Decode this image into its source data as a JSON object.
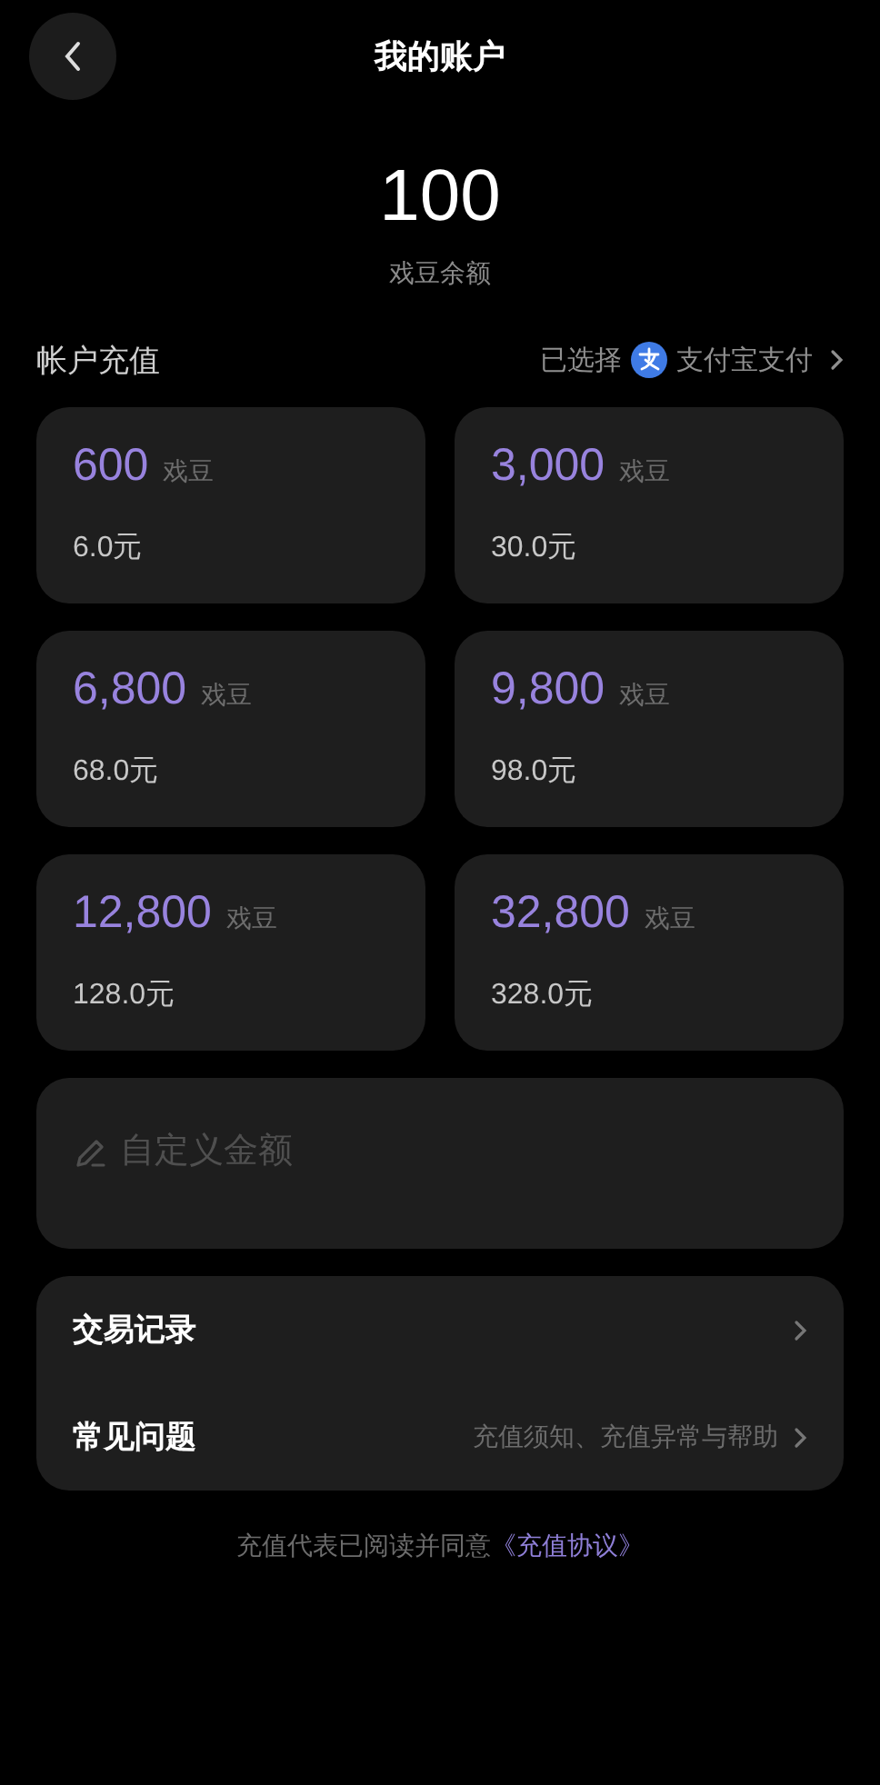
{
  "header": {
    "title": "我的账户"
  },
  "balance": {
    "amount": "100",
    "label": "戏豆余额"
  },
  "recharge": {
    "title": "帐户充值",
    "payment_prefix": "已选择",
    "payment_method": "支付宝支付"
  },
  "packages": [
    {
      "beans": "600",
      "unit": "戏豆",
      "price": "6.0元",
      "selected": false
    },
    {
      "beans": "3,000",
      "unit": "戏豆",
      "price": "30.0元",
      "selected": false
    },
    {
      "beans": "6,800",
      "unit": "戏豆",
      "price": "68.0元",
      "selected": false
    },
    {
      "beans": "9,800",
      "unit": "戏豆",
      "price": "98.0元",
      "selected": false
    },
    {
      "beans": "12,800",
      "unit": "戏豆",
      "price": "128.0元",
      "selected": false
    },
    {
      "beans": "32,800",
      "unit": "戏豆",
      "price": "328.0元",
      "selected": false
    }
  ],
  "custom_amount": {
    "placeholder": "自定义金额"
  },
  "menu": [
    {
      "label": "交易记录"
    },
    {
      "label": "常见问题",
      "detail": "充值须知、充值异常与帮助"
    }
  ],
  "footer": {
    "text": "充值代表已阅读并同意",
    "link": "《充值协议》"
  }
}
